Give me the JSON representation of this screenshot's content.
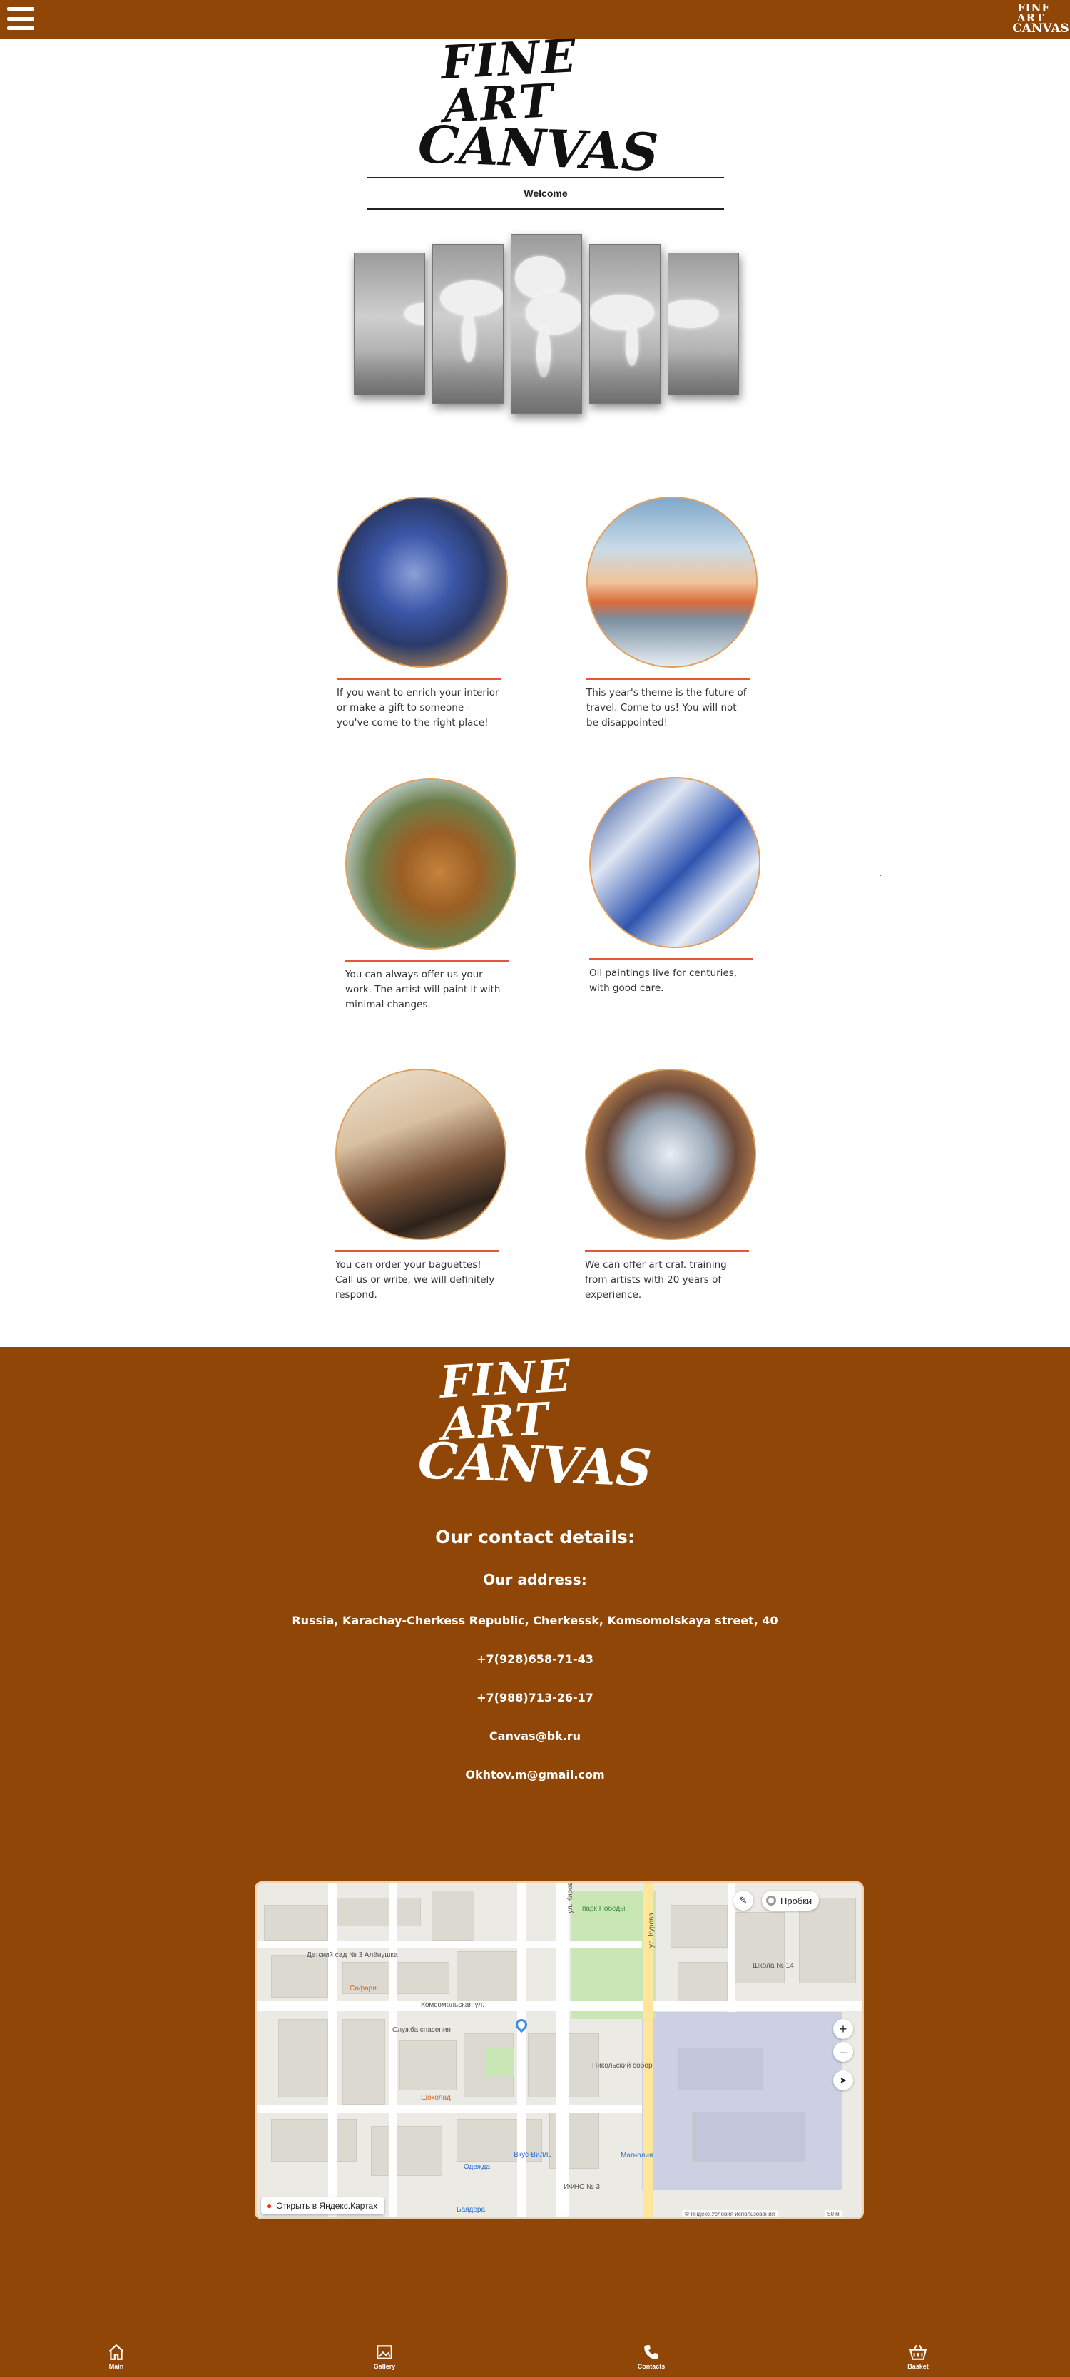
{
  "header": {
    "logo_line1": "FINE ART",
    "logo_line2": "CANVAS"
  },
  "logo": {
    "line1": "FINE ART",
    "line2": "CANVAS"
  },
  "welcome_label": "Welcome",
  "features": [
    {
      "text": "If you want to enrich your interior or make a gift to someone - you've come to the right place!",
      "image": "flowers-painting"
    },
    {
      "text": "This year's theme is the future of travel. Come to us! You will not be disappointed!",
      "image": "winter-landscape"
    },
    {
      "text": "You can always offer us your work. The artist will paint it with minimal changes.",
      "image": "cat-painting"
    },
    {
      "text": "Oil paintings live for centuries, with good care.",
      "image": "paint-tubes"
    },
    {
      "text": "You can order your baguettes! Call us or write, we will definitely respond.",
      "image": "brushes"
    },
    {
      "text": "We can offer art craf. training from artists with 20 years of experience.",
      "image": "framed-painting"
    }
  ],
  "footer": {
    "logo_line1": "FINE ART",
    "logo_line2": "CANVAS",
    "contact_heading": "Our contact details:",
    "address_heading": "Our address:",
    "address": "Russia, Karachay-Cherkess Republic, Cherkessk, Komsomolskaya street, 40",
    "phone1": "+7(928)658-71-43",
    "phone2": "+7(988)713-26-17",
    "email1": "Canvas@bk.ru",
    "email2": "Okhtov.m@gmail.com"
  },
  "map": {
    "traffic_label": "Пробки",
    "open_label": "Открыть в Яндекс.Картах",
    "copyright": "© Яндекс  Условия использования",
    "scale": "50 м",
    "labels": {
      "park": "парк Победы",
      "street1": "Комсомольская ул.",
      "street2": "ул. Кирова",
      "street3": "ул. Курова",
      "poi1": "Служба спасения",
      "poi2": "Никольский собор",
      "poi3": "ИФНС № 3",
      "poi4": "Сафари",
      "poi5": "Детский сад № 3 Алёнушка",
      "poi6": "Школа № 14",
      "poi7": "Вкус-Вилль",
      "poi8": "Магнолия",
      "poi9": "Баядера",
      "poi10": "Одежда",
      "poi11": "Шоколад"
    }
  },
  "nav": {
    "main": "Main",
    "gallery": "Gallery",
    "contacts": "Contacts",
    "basket": "Basket"
  }
}
